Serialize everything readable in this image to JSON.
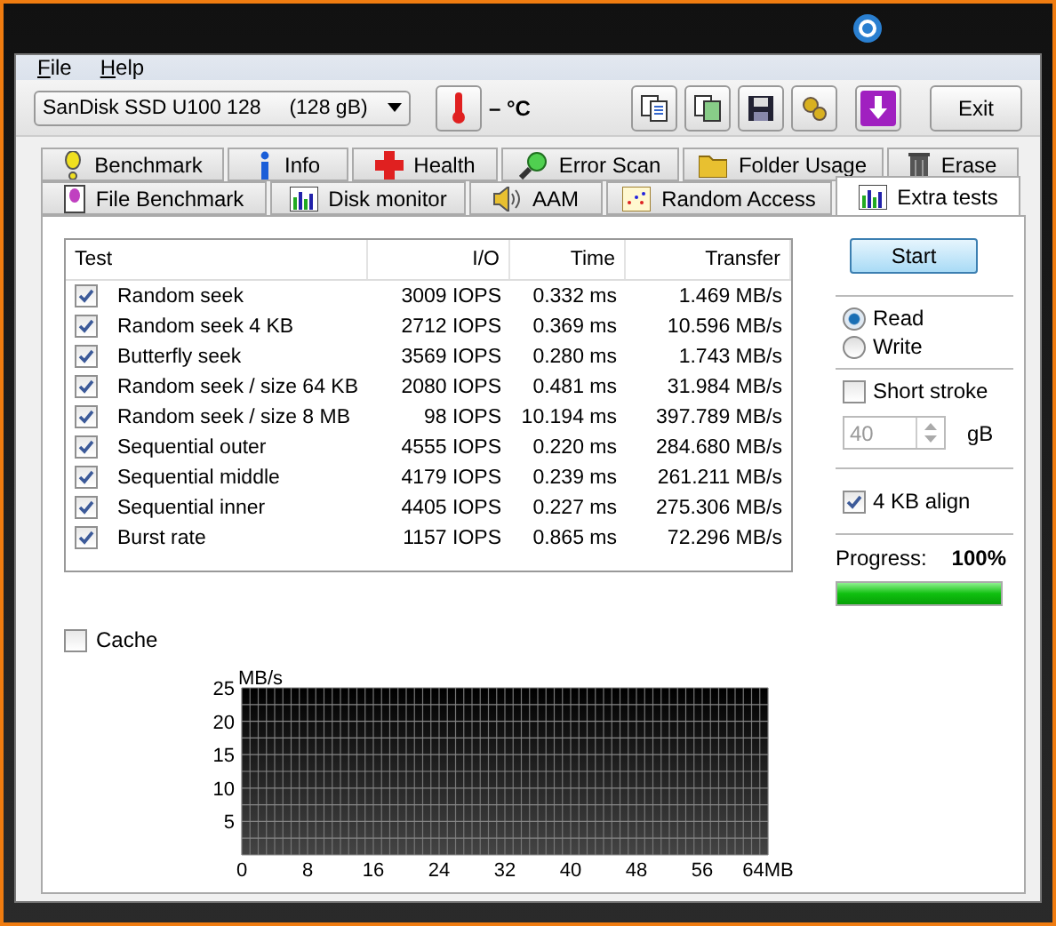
{
  "menu": [
    {
      "label": "File"
    },
    {
      "label": "Help"
    }
  ],
  "toolbar": {
    "drive": "SanDisk SSD U100 128     (128 gB)",
    "temperature": "– °C",
    "exit": "Exit"
  },
  "tabs_row1": [
    {
      "label": "Benchmark",
      "selected": false
    },
    {
      "label": "Info",
      "selected": false
    },
    {
      "label": "Health",
      "selected": false
    },
    {
      "label": "Error Scan",
      "selected": false
    },
    {
      "label": "Folder Usage",
      "selected": false
    },
    {
      "label": "Erase",
      "selected": false
    }
  ],
  "tabs_row2": [
    {
      "label": "File Benchmark",
      "selected": false
    },
    {
      "label": "Disk monitor",
      "selected": false
    },
    {
      "label": "AAM",
      "selected": false
    },
    {
      "label": "Random Access",
      "selected": false
    },
    {
      "label": "Extra tests",
      "selected": true
    }
  ],
  "table": {
    "columns": [
      "Test",
      "I/O",
      "Time",
      "Transfer"
    ],
    "rows": [
      {
        "test": "Random seek",
        "io": "3009 IOPS",
        "time": "0.332 ms",
        "transfer": "1.469 MB/s",
        "checked": true
      },
      {
        "test": "Random seek 4 KB",
        "io": "2712 IOPS",
        "time": "0.369 ms",
        "transfer": "10.596 MB/s",
        "checked": true
      },
      {
        "test": "Butterfly seek",
        "io": "3569 IOPS",
        "time": "0.280 ms",
        "transfer": "1.743 MB/s",
        "checked": true
      },
      {
        "test": "Random seek / size 64 KB",
        "io": "2080 IOPS",
        "time": "0.481 ms",
        "transfer": "31.984 MB/s",
        "checked": true
      },
      {
        "test": "Random seek / size 8 MB",
        "io": "98 IOPS",
        "time": "10.194 ms",
        "transfer": "397.789 MB/s",
        "checked": true
      },
      {
        "test": "Sequential outer",
        "io": "4555 IOPS",
        "time": "0.220 ms",
        "transfer": "284.680 MB/s",
        "checked": true
      },
      {
        "test": "Sequential middle",
        "io": "4179 IOPS",
        "time": "0.239 ms",
        "transfer": "261.211 MB/s",
        "checked": true
      },
      {
        "test": "Sequential inner",
        "io": "4405 IOPS",
        "time": "0.227 ms",
        "transfer": "275.306 MB/s",
        "checked": true
      },
      {
        "test": "Burst rate",
        "io": "1157 IOPS",
        "time": "0.865 ms",
        "transfer": "72.296 MB/s",
        "checked": true
      }
    ]
  },
  "cache": {
    "label": "Cache",
    "checked": false
  },
  "side": {
    "start": "Start",
    "modes": [
      {
        "label": "Read",
        "selected": true
      },
      {
        "label": "Write",
        "selected": false
      }
    ],
    "short_stroke": {
      "label": "Short stroke",
      "checked": false,
      "value": "40",
      "unit": "gB",
      "disabled": true
    },
    "align": {
      "label": "4 KB align",
      "checked": true
    },
    "progress": {
      "label": "Progress:",
      "value": "100%",
      "level": 1
    }
  },
  "chart": {
    "chart_data": {
      "type": "line",
      "ylabel": "MB/s",
      "xlim": [
        0,
        64
      ],
      "ylim": [
        0,
        25
      ],
      "xticks": [
        0,
        8,
        16,
        24,
        32,
        40,
        48,
        56,
        {
          "value": 64,
          "label": "64MB"
        }
      ],
      "yticks": [
        5,
        10,
        15,
        20,
        25
      ],
      "grid": true
    }
  }
}
